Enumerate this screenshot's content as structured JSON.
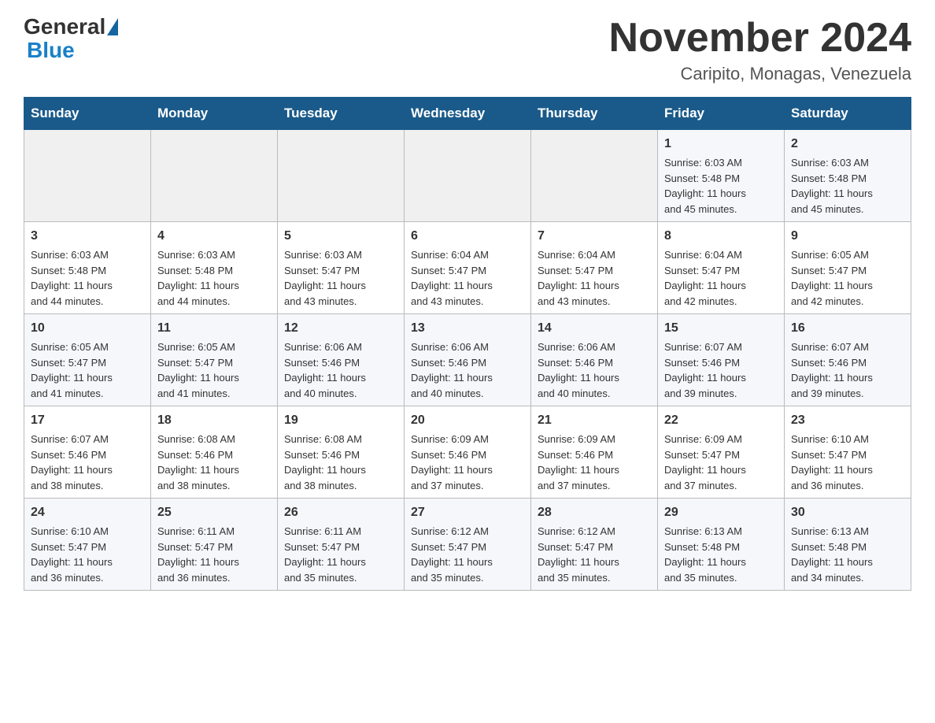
{
  "header": {
    "logo_general": "General",
    "logo_blue": "Blue",
    "month_title": "November 2024",
    "location": "Caripito, Monagas, Venezuela"
  },
  "weekdays": [
    "Sunday",
    "Monday",
    "Tuesday",
    "Wednesday",
    "Thursday",
    "Friday",
    "Saturday"
  ],
  "weeks": [
    [
      {
        "day": "",
        "info": ""
      },
      {
        "day": "",
        "info": ""
      },
      {
        "day": "",
        "info": ""
      },
      {
        "day": "",
        "info": ""
      },
      {
        "day": "",
        "info": ""
      },
      {
        "day": "1",
        "info": "Sunrise: 6:03 AM\nSunset: 5:48 PM\nDaylight: 11 hours\nand 45 minutes."
      },
      {
        "day": "2",
        "info": "Sunrise: 6:03 AM\nSunset: 5:48 PM\nDaylight: 11 hours\nand 45 minutes."
      }
    ],
    [
      {
        "day": "3",
        "info": "Sunrise: 6:03 AM\nSunset: 5:48 PM\nDaylight: 11 hours\nand 44 minutes."
      },
      {
        "day": "4",
        "info": "Sunrise: 6:03 AM\nSunset: 5:48 PM\nDaylight: 11 hours\nand 44 minutes."
      },
      {
        "day": "5",
        "info": "Sunrise: 6:03 AM\nSunset: 5:47 PM\nDaylight: 11 hours\nand 43 minutes."
      },
      {
        "day": "6",
        "info": "Sunrise: 6:04 AM\nSunset: 5:47 PM\nDaylight: 11 hours\nand 43 minutes."
      },
      {
        "day": "7",
        "info": "Sunrise: 6:04 AM\nSunset: 5:47 PM\nDaylight: 11 hours\nand 43 minutes."
      },
      {
        "day": "8",
        "info": "Sunrise: 6:04 AM\nSunset: 5:47 PM\nDaylight: 11 hours\nand 42 minutes."
      },
      {
        "day": "9",
        "info": "Sunrise: 6:05 AM\nSunset: 5:47 PM\nDaylight: 11 hours\nand 42 minutes."
      }
    ],
    [
      {
        "day": "10",
        "info": "Sunrise: 6:05 AM\nSunset: 5:47 PM\nDaylight: 11 hours\nand 41 minutes."
      },
      {
        "day": "11",
        "info": "Sunrise: 6:05 AM\nSunset: 5:47 PM\nDaylight: 11 hours\nand 41 minutes."
      },
      {
        "day": "12",
        "info": "Sunrise: 6:06 AM\nSunset: 5:46 PM\nDaylight: 11 hours\nand 40 minutes."
      },
      {
        "day": "13",
        "info": "Sunrise: 6:06 AM\nSunset: 5:46 PM\nDaylight: 11 hours\nand 40 minutes."
      },
      {
        "day": "14",
        "info": "Sunrise: 6:06 AM\nSunset: 5:46 PM\nDaylight: 11 hours\nand 40 minutes."
      },
      {
        "day": "15",
        "info": "Sunrise: 6:07 AM\nSunset: 5:46 PM\nDaylight: 11 hours\nand 39 minutes."
      },
      {
        "day": "16",
        "info": "Sunrise: 6:07 AM\nSunset: 5:46 PM\nDaylight: 11 hours\nand 39 minutes."
      }
    ],
    [
      {
        "day": "17",
        "info": "Sunrise: 6:07 AM\nSunset: 5:46 PM\nDaylight: 11 hours\nand 38 minutes."
      },
      {
        "day": "18",
        "info": "Sunrise: 6:08 AM\nSunset: 5:46 PM\nDaylight: 11 hours\nand 38 minutes."
      },
      {
        "day": "19",
        "info": "Sunrise: 6:08 AM\nSunset: 5:46 PM\nDaylight: 11 hours\nand 38 minutes."
      },
      {
        "day": "20",
        "info": "Sunrise: 6:09 AM\nSunset: 5:46 PM\nDaylight: 11 hours\nand 37 minutes."
      },
      {
        "day": "21",
        "info": "Sunrise: 6:09 AM\nSunset: 5:46 PM\nDaylight: 11 hours\nand 37 minutes."
      },
      {
        "day": "22",
        "info": "Sunrise: 6:09 AM\nSunset: 5:47 PM\nDaylight: 11 hours\nand 37 minutes."
      },
      {
        "day": "23",
        "info": "Sunrise: 6:10 AM\nSunset: 5:47 PM\nDaylight: 11 hours\nand 36 minutes."
      }
    ],
    [
      {
        "day": "24",
        "info": "Sunrise: 6:10 AM\nSunset: 5:47 PM\nDaylight: 11 hours\nand 36 minutes."
      },
      {
        "day": "25",
        "info": "Sunrise: 6:11 AM\nSunset: 5:47 PM\nDaylight: 11 hours\nand 36 minutes."
      },
      {
        "day": "26",
        "info": "Sunrise: 6:11 AM\nSunset: 5:47 PM\nDaylight: 11 hours\nand 35 minutes."
      },
      {
        "day": "27",
        "info": "Sunrise: 6:12 AM\nSunset: 5:47 PM\nDaylight: 11 hours\nand 35 minutes."
      },
      {
        "day": "28",
        "info": "Sunrise: 6:12 AM\nSunset: 5:47 PM\nDaylight: 11 hours\nand 35 minutes."
      },
      {
        "day": "29",
        "info": "Sunrise: 6:13 AM\nSunset: 5:48 PM\nDaylight: 11 hours\nand 35 minutes."
      },
      {
        "day": "30",
        "info": "Sunrise: 6:13 AM\nSunset: 5:48 PM\nDaylight: 11 hours\nand 34 minutes."
      }
    ]
  ]
}
